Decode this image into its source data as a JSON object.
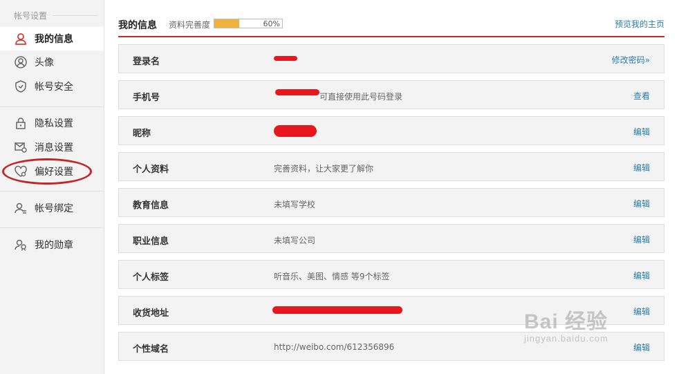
{
  "sidebar": {
    "section_title": "帐号设置",
    "items": [
      {
        "label": "我的信息",
        "icon": "user-icon",
        "active": true
      },
      {
        "label": "头像",
        "icon": "avatar-icon"
      },
      {
        "label": "帐号安全",
        "icon": "shield-icon"
      },
      {
        "label": "隐私设置",
        "icon": "lock-icon"
      },
      {
        "label": "消息设置",
        "icon": "message-settings-icon"
      },
      {
        "label": "偏好设置",
        "icon": "heart-settings-icon"
      },
      {
        "label": "帐号绑定",
        "icon": "user-link-icon"
      },
      {
        "label": "我的勋章",
        "icon": "medal-icon"
      }
    ]
  },
  "header": {
    "title": "我的信息",
    "completion_label": "资料完善度",
    "completion_percent_text": "60%",
    "completion_value": 0.6,
    "preview_link": "预览我的主页"
  },
  "rows": [
    {
      "label": "登录名",
      "value": "",
      "redacted": true,
      "action": "修改密码»"
    },
    {
      "label": "手机号",
      "value": "可直接使用此号码登录",
      "redacted": true,
      "action": "查看"
    },
    {
      "label": "昵称",
      "value": "",
      "redacted": true,
      "action": "编辑"
    },
    {
      "label": "个人资料",
      "value": "完善资料，让大家更了解你",
      "action": "编辑"
    },
    {
      "label": "教育信息",
      "value": "未填写学校",
      "action": "编辑"
    },
    {
      "label": "职业信息",
      "value": "未填写公司",
      "action": "编辑"
    },
    {
      "label": "个人标签",
      "value": "听音乐、美图、情感 等9个标签",
      "action": "编辑"
    },
    {
      "label": "收货地址",
      "value": "",
      "redacted": true,
      "action": "编辑"
    },
    {
      "label": "个性域名",
      "value": "http://weibo.com/612356896",
      "action": "编辑"
    }
  ],
  "watermark": {
    "top": "Bai 经验",
    "bottom": "jingyan.baidu.com"
  },
  "colors": {
    "accent_red": "#c8272b",
    "link_blue": "#2a7fa8",
    "progress_fill": "#f0b13d"
  }
}
